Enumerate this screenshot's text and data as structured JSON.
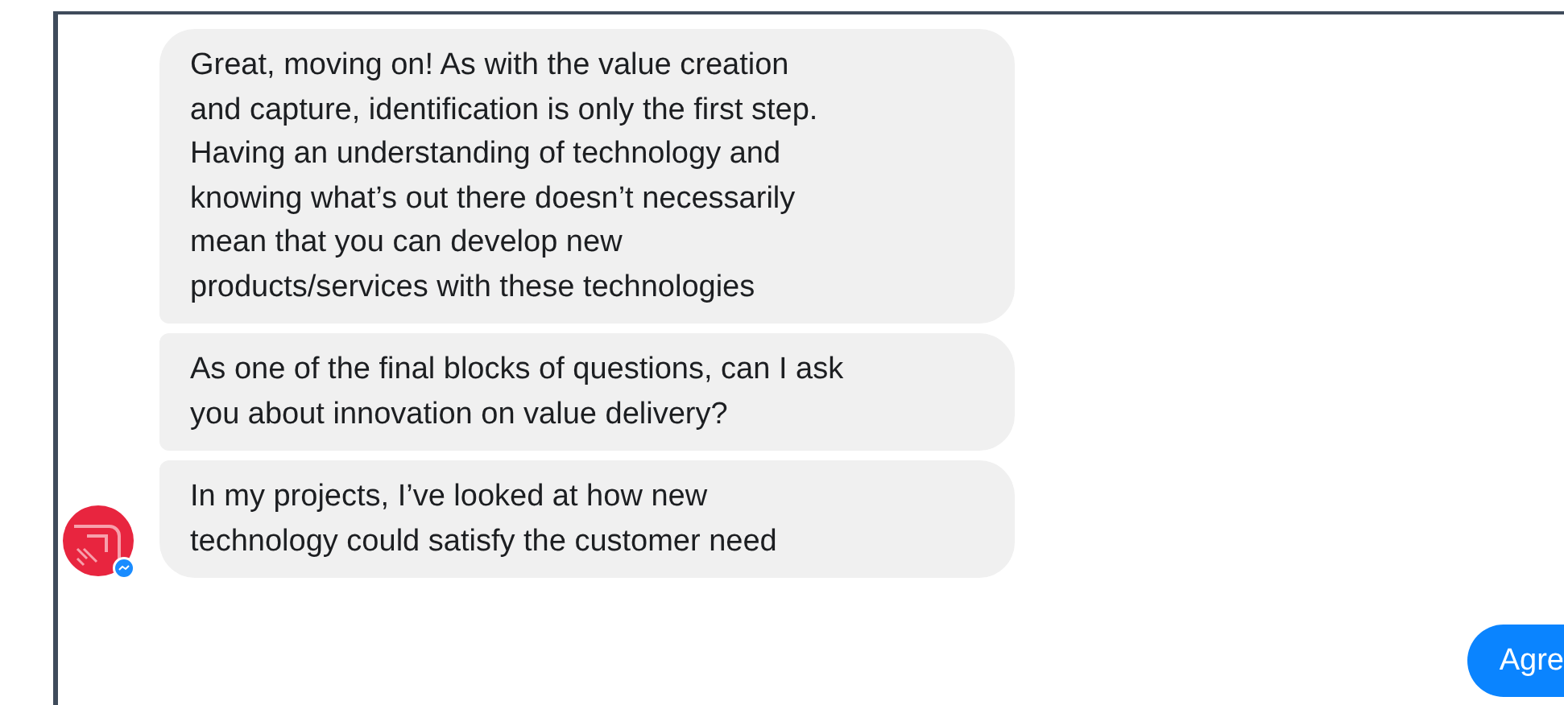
{
  "incoming": {
    "messages": [
      {
        "text": "Great, moving on! As with the value creation\nand capture, identification is only the first step.\nHaving an understanding of technology and\nknowing what’s out there doesn’t necessarily\nmean that you can develop new\nproducts/services with these technologies"
      },
      {
        "text": "As one of the final blocks of questions, can I ask\nyou about innovation on value delivery?"
      },
      {
        "text": "In my projects, I’ve looked at how new\ntechnology could satisfy the customer need"
      }
    ]
  },
  "outgoing": {
    "messages": [
      {
        "text": "Agre"
      }
    ]
  }
}
